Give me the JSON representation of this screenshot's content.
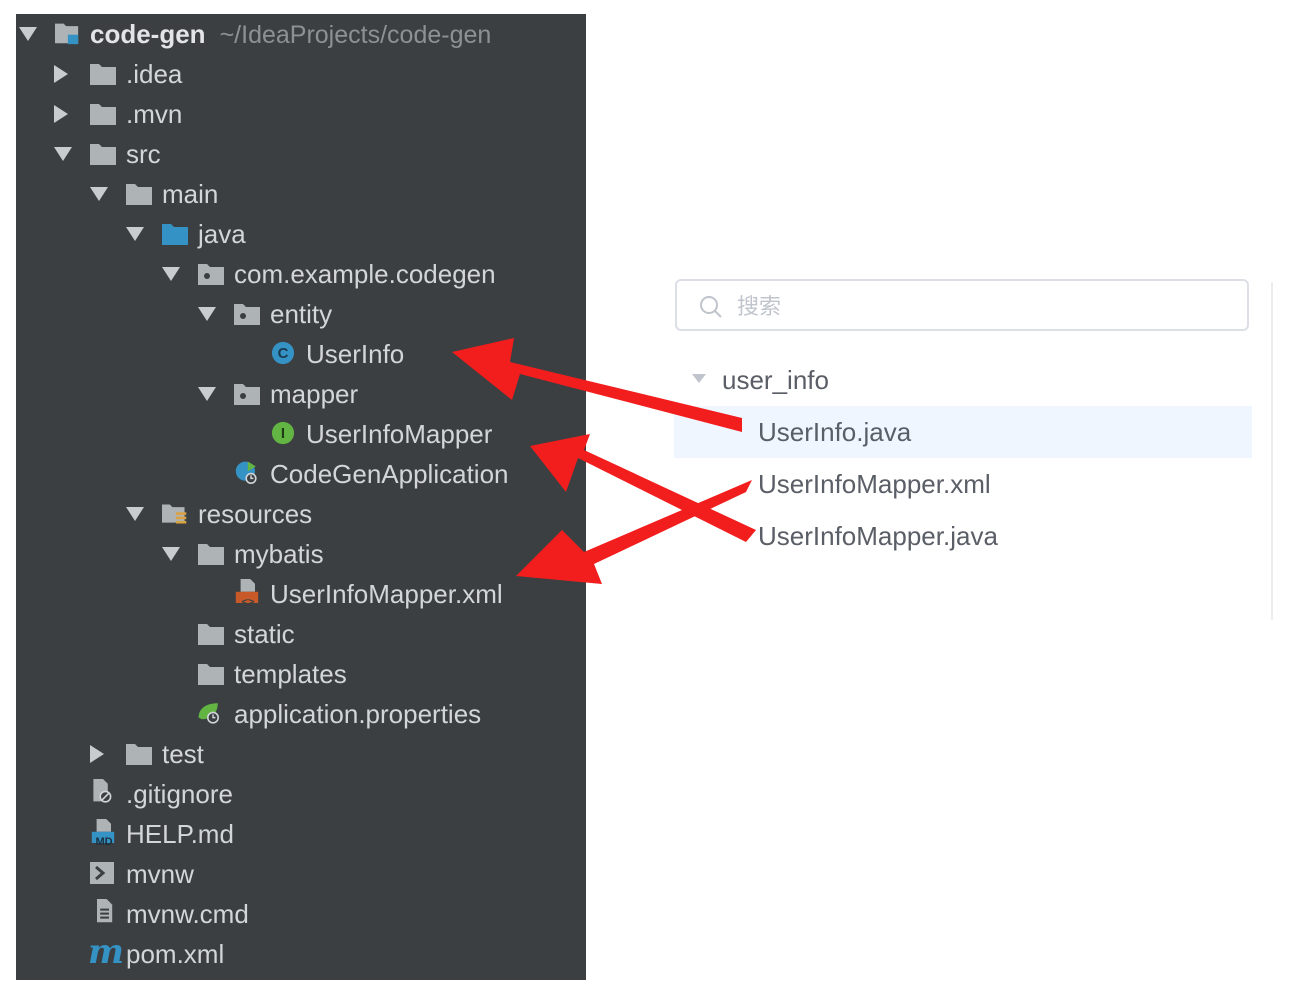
{
  "project_tree": {
    "root": {
      "name": "code-gen",
      "path": "~/IdeaProjects/code-gen"
    },
    "items": [
      {
        "label": ".idea"
      },
      {
        "label": ".mvn"
      },
      {
        "label": "src"
      },
      {
        "label": "main"
      },
      {
        "label": "java"
      },
      {
        "label": "com.example.codegen"
      },
      {
        "label": "entity"
      },
      {
        "label": "UserInfo",
        "icon_letter": "C"
      },
      {
        "label": "mapper"
      },
      {
        "label": "UserInfoMapper",
        "icon_letter": "I"
      },
      {
        "label": "CodeGenApplication"
      },
      {
        "label": "resources"
      },
      {
        "label": "mybatis"
      },
      {
        "label": "UserInfoMapper.xml",
        "icon_text": "<>"
      },
      {
        "label": "static"
      },
      {
        "label": "templates"
      },
      {
        "label": "application.properties"
      },
      {
        "label": "test"
      },
      {
        "label": ".gitignore"
      },
      {
        "label": "HELP.md",
        "icon_text": "MD"
      },
      {
        "label": "mvnw"
      },
      {
        "label": "mvnw.cmd"
      },
      {
        "label": "pom.xml",
        "icon_text": "m"
      }
    ]
  },
  "generator": {
    "search": {
      "placeholder": "搜索",
      "value": ""
    },
    "table_node": "user_info",
    "files": [
      "UserInfo.java",
      "UserInfoMapper.xml",
      "UserInfoMapper.java"
    ],
    "selected_file": "UserInfo.java"
  },
  "colors": {
    "ide_background": "#3c3f41",
    "folder": "#aeb3b6",
    "source_folder": "#3592c4",
    "class_icon": "#3592c4",
    "interface_icon": "#62b543",
    "xml_icon": "#c75a28",
    "arrow": "#f21d1d",
    "selected_row": "#f0f6ff"
  },
  "icons": {
    "folder": "folder-icon",
    "package": "package-icon",
    "class": "class-icon",
    "interface": "interface-icon",
    "spring": "spring-boot-icon",
    "xml": "xml-file-icon",
    "search": "search-icon",
    "expand": "triangle-down-icon",
    "collapsed": "triangle-right-icon"
  }
}
